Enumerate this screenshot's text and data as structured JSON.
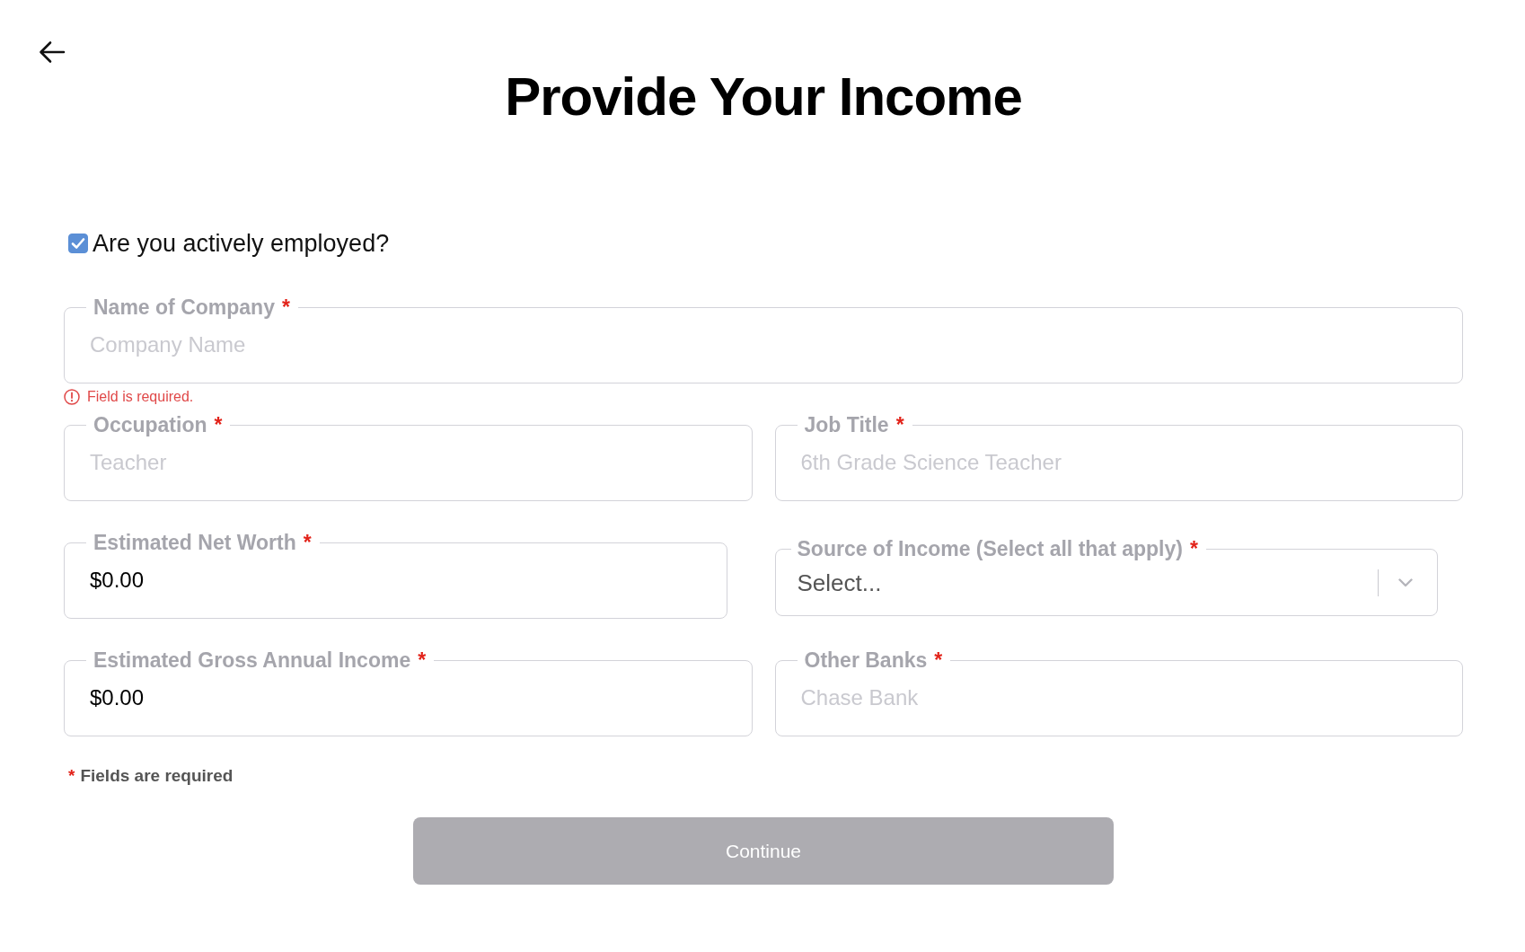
{
  "header": {
    "title": "Provide Your Income"
  },
  "employment": {
    "label": "Are you actively employed?",
    "checked": true
  },
  "fields": [
    {
      "kind": "text",
      "label": "Name of Company",
      "required_mark": "*",
      "placeholder": "Company Name",
      "error": "Field is required."
    },
    {
      "kind": "text",
      "label": "Occupation",
      "required_mark": "*",
      "placeholder": "Teacher"
    },
    {
      "kind": "text",
      "label": "Job Title",
      "required_mark": "*",
      "placeholder": "6th Grade Science Teacher"
    },
    {
      "kind": "text",
      "label": "Estimated Net Worth",
      "required_mark": "*",
      "value": "$0.00"
    },
    {
      "kind": "select",
      "label": "Source of Income (Select all that apply)",
      "required_mark": "*",
      "placeholder": "Select..."
    },
    {
      "kind": "text",
      "label": "Estimated Gross Annual Income",
      "required_mark": "*",
      "value": "$0.00"
    },
    {
      "kind": "text",
      "label": "Other Banks",
      "required_mark": "*",
      "placeholder": "Chase Bank"
    }
  ],
  "required_note": {
    "mark": "*",
    "text": "Fields are required"
  },
  "continue_button": {
    "label": "Continue",
    "disabled": true
  }
}
